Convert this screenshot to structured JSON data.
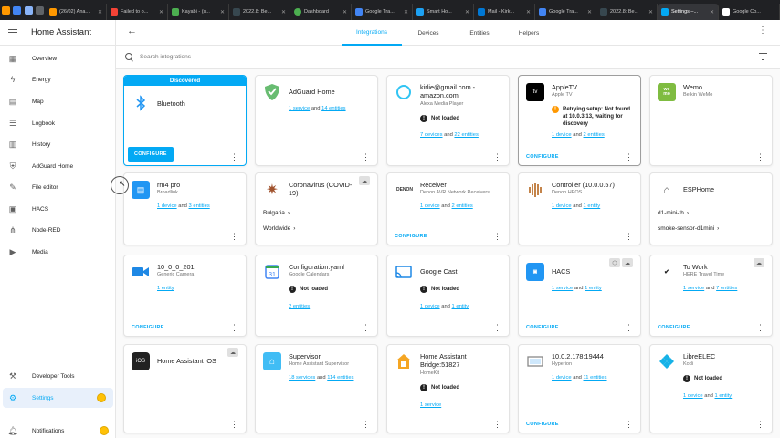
{
  "browser_tabs": [
    {
      "title": "(26/02) Ana...",
      "color": "#ff9800"
    },
    {
      "title": "Failed to o...",
      "color": "#f44336"
    },
    {
      "title": "Kayabi - (s...",
      "color": "#4caf50"
    },
    {
      "title": "2022.8: Be...",
      "color": "#37474f"
    },
    {
      "title": "Dashboard",
      "color": "#4caf50"
    },
    {
      "title": "Google Tra...",
      "color": "#4285f4"
    },
    {
      "title": "Smart Ho...",
      "color": "#1da1f2"
    },
    {
      "title": "Mail - Kirk...",
      "color": "#0078d4"
    },
    {
      "title": "Google Tra...",
      "color": "#4285f4"
    },
    {
      "title": "2022.8: Be...",
      "color": "#37474f"
    },
    {
      "title": "Settings –...",
      "color": "#03a9f4"
    },
    {
      "title": "Google Co...",
      "color": "#ffffff"
    }
  ],
  "sidebar": {
    "title": "Home Assistant",
    "items": [
      {
        "label": "Overview",
        "icon": "▦"
      },
      {
        "label": "Energy",
        "icon": "⚡"
      },
      {
        "label": "Map",
        "icon": "▤"
      },
      {
        "label": "Logbook",
        "icon": "☰"
      },
      {
        "label": "History",
        "icon": "▥"
      },
      {
        "label": "AdGuard Home",
        "icon": "⛨"
      },
      {
        "label": "File editor",
        "icon": "🔧"
      },
      {
        "label": "HACS",
        "icon": "▣"
      },
      {
        "label": "Node-RED",
        "icon": "⋔"
      },
      {
        "label": "Media",
        "icon": "▶"
      }
    ],
    "developer_tools": "Developer Tools",
    "settings": "Settings",
    "notifications": "Notifications"
  },
  "topbar": {
    "tabs": [
      "Integrations",
      "Devices",
      "Entities",
      "Helpers"
    ],
    "active_tab": "Integrations"
  },
  "search": {
    "placeholder": "Search integrations"
  },
  "labels": {
    "configure": "CONFIGURE",
    "not_loaded": "Not loaded",
    "discovered": "Discovered"
  },
  "cards": {
    "bluetooth": {
      "title": "Bluetooth"
    },
    "adguard": {
      "title": "AdGuard Home",
      "l1": "1 service",
      "and": "and",
      "l2": "14 entities"
    },
    "alexa": {
      "title": "kirlie@gmail.com - amazon.com",
      "sub": "Alexa Media Player",
      "l1": "7 devices",
      "and": "and",
      "l2": "22 entities"
    },
    "appletv": {
      "title": "AppleTV",
      "sub": "Apple TV",
      "status": "Retrying setup: Not found at 10.0.3.13, waiting for discovery",
      "l1": "1 device",
      "and": "and",
      "l2": "2 entities"
    },
    "wemo": {
      "title": "Wemo",
      "sub": "Belkin WeMo"
    },
    "rm4": {
      "title": "rm4 pro",
      "sub": "Broadlink",
      "l1": "1 device",
      "and": "and",
      "l2": "3 entities"
    },
    "covid": {
      "title": "Coronavirus (COVID-19)",
      "e1": "Bulgaria",
      "e2": "Worldwide"
    },
    "receiver": {
      "title": "Receiver",
      "sub": "Denon AVR Network Receivers",
      "l1": "1 device",
      "and": "and",
      "l2": "2 entities"
    },
    "controller": {
      "title": "Controller (10.0.0.57)",
      "sub": "Denon HEOS",
      "l1": "1 device",
      "and": "and",
      "l2": "1 entity"
    },
    "esphome": {
      "title": "ESPHome",
      "e1": "d1-mini-th",
      "e2": "smoke-sensor-d1mini"
    },
    "camera": {
      "title": "10_0_0_201",
      "sub": "Generic Camera",
      "l1": "1 entity"
    },
    "config_yaml": {
      "title": "Configuration.yaml",
      "sub": "Google Calendars",
      "l1": "2 entities"
    },
    "google_cast": {
      "title": "Google Cast",
      "l1": "1 device",
      "and": "and",
      "l2": "1 entity"
    },
    "hacs": {
      "title": "HACS",
      "l1": "1 service",
      "and": "and",
      "l2": "1 entity"
    },
    "towork": {
      "title": "To Work",
      "sub": "HERE Travel Time",
      "l1": "1 service",
      "and": "and",
      "l2": "7 entities"
    },
    "ios": {
      "title": "Home Assistant iOS"
    },
    "supervisor": {
      "title": "Supervisor",
      "sub": "Home Assistant Supervisor",
      "l1": "18 services",
      "and": "and",
      "l2": "114 entities"
    },
    "bridge": {
      "title": "Home Assistant Bridge:51827",
      "sub": "HomeKit",
      "l1": "1 service"
    },
    "hyperion": {
      "title": "10.0.2.178:19444",
      "sub": "Hyperion",
      "l1": "1 device",
      "and": "and",
      "l2": "11 entities"
    },
    "libreelec": {
      "title": "LibreELEC",
      "sub": "Kodi",
      "l1": "1 device",
      "and": "and",
      "l2": "1 entity"
    }
  },
  "colors": {
    "accent": "#03a9f4",
    "warning": "#ff9800",
    "badge": "#ffc107"
  }
}
